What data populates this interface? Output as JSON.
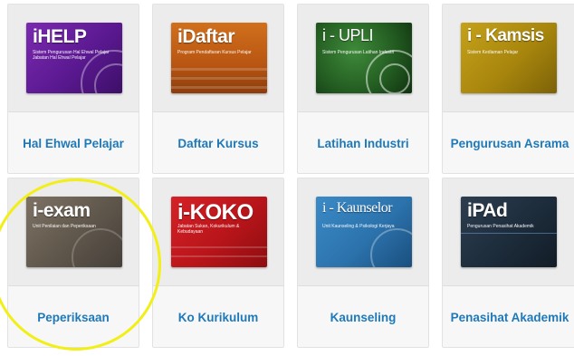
{
  "tiles": [
    {
      "title": "iHELP",
      "subtitle": "Sistem Pengurusan Hal Ehwal Pelajar Jabatan Hal Ehwal Pelajar",
      "label": "Hal Ehwal Pelajar",
      "icon": "ihelp-thumbnail"
    },
    {
      "title": "iDaftar",
      "subtitle": "Program Pendaftaran Kursus Pelajar",
      "label": "Daftar Kursus",
      "icon": "idaftar-thumbnail"
    },
    {
      "title": "i - UPLI",
      "subtitle": "Sistem Pengurusan Latihan Industri",
      "label": "Latihan Industri",
      "icon": "iupli-thumbnail"
    },
    {
      "title": "i - Kamsis",
      "subtitle": "Sistem Kediaman Pelajar",
      "label": "Pengurusan Asrama",
      "icon": "ikamsis-thumbnail"
    },
    {
      "title": "i-exam",
      "subtitle": "Unit Penilaian dan Peperiksaan",
      "label": "Peperiksaan",
      "icon": "iexam-thumbnail"
    },
    {
      "title": "i-KOKO",
      "subtitle": "Jabatan Sukan, Kokurikulum & Kebudayaan",
      "label": "Ko Kurikulum",
      "icon": "ikoko-thumbnail"
    },
    {
      "title": "i - Kaunselor",
      "subtitle": "Unit Kaunseling & Psikologi Kerjaya",
      "label": "Kaunseling",
      "icon": "ikaunselor-thumbnail"
    },
    {
      "title": "iPAd",
      "subtitle": "Pengurusan Penasihat Akademik",
      "label": "Penasihat Akademik",
      "icon": "ipad-thumbnail"
    }
  ],
  "colors": {
    "label": "#1f79b8",
    "highlight": "#f2ef17"
  }
}
